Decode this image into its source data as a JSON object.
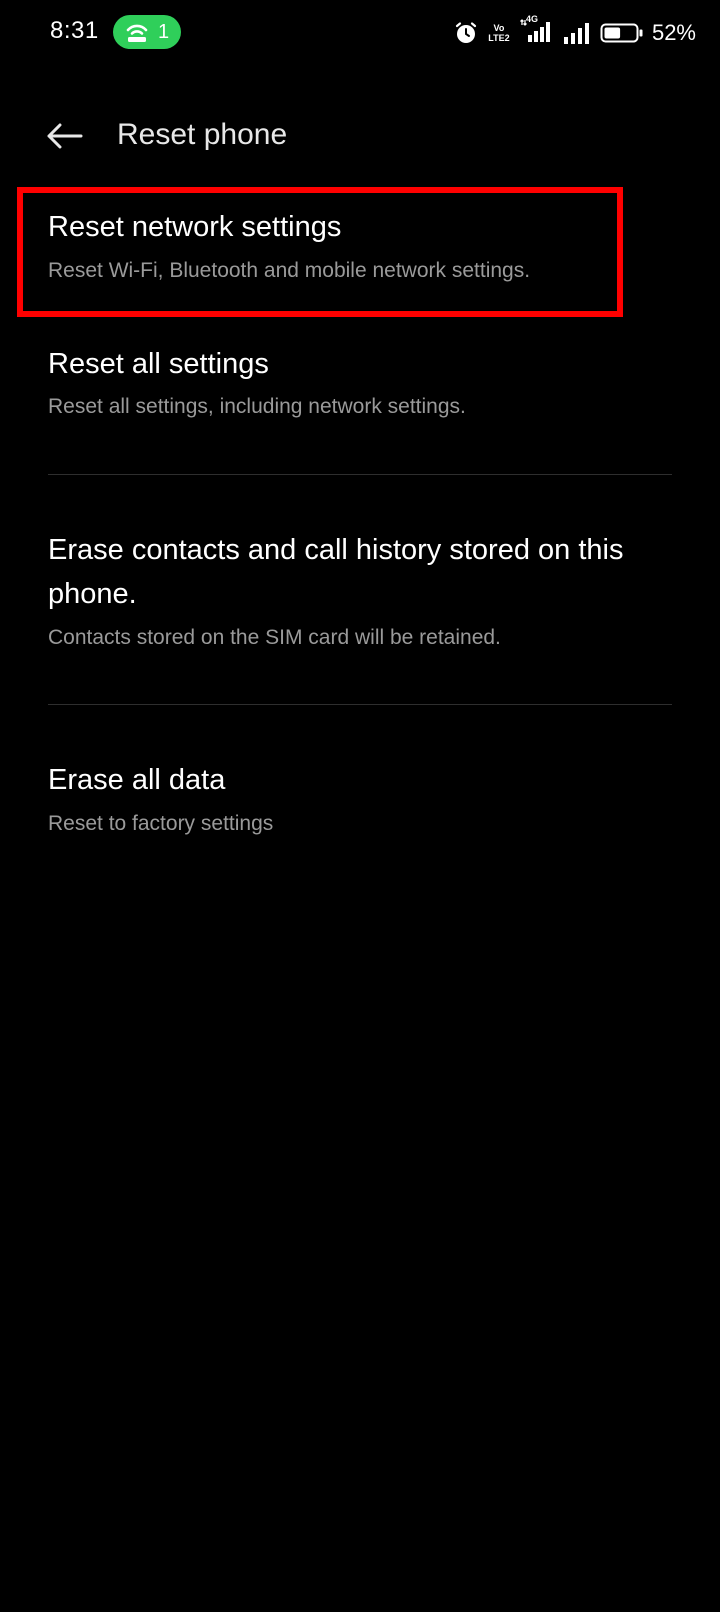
{
  "status_bar": {
    "time": "8:31",
    "hotspot_count": "1",
    "volte_label": "Vo LTE2",
    "network_type": "4G",
    "battery_percent": "52%",
    "battery_level": 0.52,
    "hotspot_color": "#2fcf5a"
  },
  "header": {
    "back_icon": "arrow-left-icon",
    "title": "Reset phone"
  },
  "options": [
    {
      "title": "Reset network settings",
      "description": "Reset Wi-Fi, Bluetooth and mobile network settings.",
      "highlighted": true
    },
    {
      "title": "Reset all settings",
      "description": "Reset all settings, including network settings."
    },
    {
      "title": "Erase contacts and call history stored on this phone.",
      "description": "Contacts stored on the SIM card will be retained."
    },
    {
      "title": "Erase all data",
      "description": "Reset to factory settings"
    }
  ],
  "highlight_color": "#ff0000"
}
